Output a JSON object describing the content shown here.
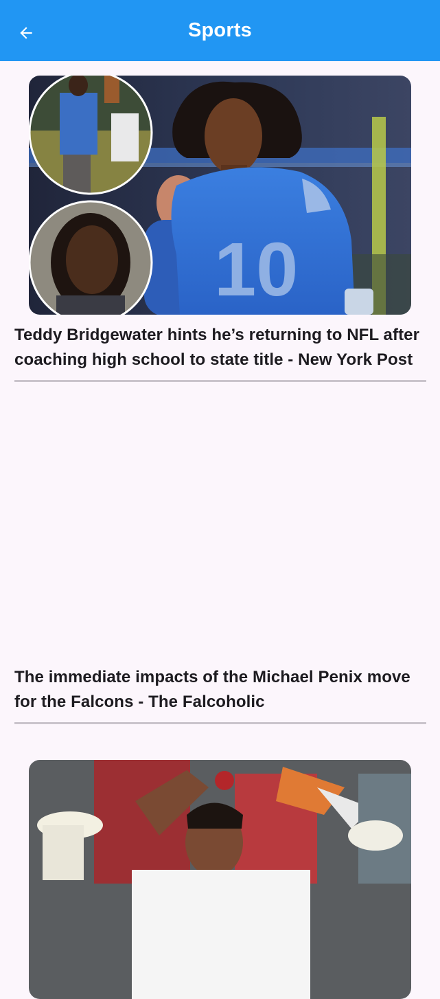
{
  "app_bar": {
    "title": "Sports",
    "back_icon": "arrow-back-icon",
    "color": "#2196f3"
  },
  "articles": [
    {
      "headline": "Teddy Bridgewater hints he’s returning to NFL after coaching high school to state title - New York Post",
      "image": "football-player-number-10-photo"
    },
    {
      "headline": "The immediate impacts of the Michael Penix move for the Falcons - The Falcoholic",
      "image": ""
    },
    {
      "headline": "",
      "image": "cricket-player-holding-ball-photo"
    }
  ]
}
